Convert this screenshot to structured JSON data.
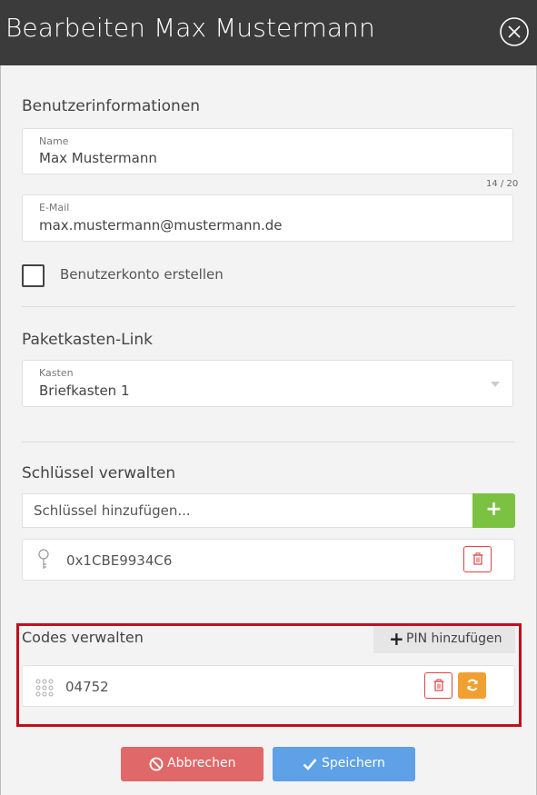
{
  "header": {
    "title": "Bearbeiten Max Mustermann"
  },
  "user_info": {
    "section_title": "Benutzerinformationen",
    "name_label": "Name",
    "name_value": "Max Mustermann",
    "name_counter": "14 / 20",
    "email_label": "E-Mail",
    "email_value": "max.mustermann@mustermann.de",
    "create_account_label": "Benutzerkonto erstellen",
    "create_account_checked": false
  },
  "parcel_box": {
    "section_title": "Paketkasten-Link",
    "box_label": "Kasten",
    "box_value": "Briefkasten 1"
  },
  "keys": {
    "section_title": "Schlüssel verwalten",
    "input_placeholder": "Schlüssel hinzufügen...",
    "add_label": "+",
    "items": [
      {
        "value": "0x1CBE9934C6"
      }
    ]
  },
  "codes": {
    "section_title": "Codes verwalten",
    "add_pin_label": "PIN hinzufügen",
    "add_pin_icon": "+",
    "items": [
      {
        "value": "04752"
      }
    ]
  },
  "footer": {
    "cancel_label": "Abbrechen",
    "save_label": "Speichern"
  },
  "colors": {
    "header_bg": "#3b3b3b",
    "add_green": "#7cc242",
    "delete_red": "#dd4444",
    "refresh_orange": "#f0a030",
    "cancel_red": "#e06868",
    "save_blue": "#5ea1e6",
    "highlight_red": "#c0101e"
  }
}
